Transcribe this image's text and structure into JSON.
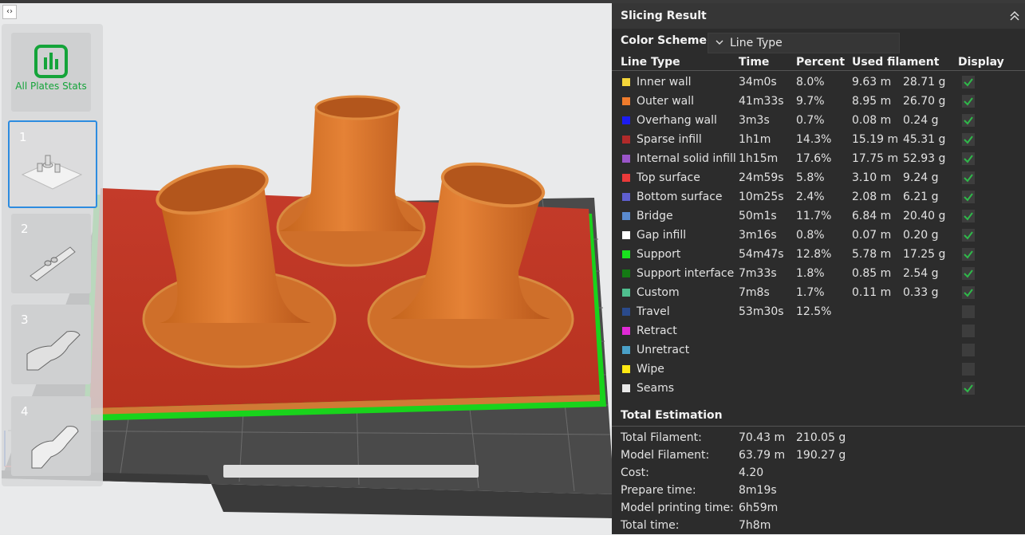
{
  "plates": {
    "stats_label": "All Plates Stats",
    "items": [
      {
        "num": "1"
      },
      {
        "num": "2"
      },
      {
        "num": "3"
      },
      {
        "num": "4"
      }
    ]
  },
  "panel": {
    "title": "Slicing Result",
    "scheme_label": "Color Scheme",
    "scheme_value": "Line Type",
    "headers": {
      "line_type": "Line Type",
      "time": "Time",
      "percent": "Percent",
      "used_filament": "Used filament",
      "display": "Display"
    },
    "rows": [
      {
        "name": "Inner wall",
        "color": "#f5d63a",
        "time": "34m0s",
        "percent": "8.0%",
        "length": "9.63 m",
        "weight": "28.71 g",
        "checked": true
      },
      {
        "name": "Outer wall",
        "color": "#ef7b2c",
        "time": "41m33s",
        "percent": "9.7%",
        "length": "8.95 m",
        "weight": "26.70 g",
        "checked": true
      },
      {
        "name": "Overhang wall",
        "color": "#1c1cf2",
        "time": "3m3s",
        "percent": "0.7%",
        "length": "0.08 m",
        "weight": "0.24 g",
        "checked": true
      },
      {
        "name": "Sparse infill",
        "color": "#b12a2a",
        "time": "1h1m",
        "percent": "14.3%",
        "length": "15.19 m",
        "weight": "45.31 g",
        "checked": true
      },
      {
        "name": "Internal solid infill",
        "color": "#9a55c9",
        "time": "1h15m",
        "percent": "17.6%",
        "length": "17.75 m",
        "weight": "52.93 g",
        "checked": true
      },
      {
        "name": "Top surface",
        "color": "#ea3a3a",
        "time": "24m59s",
        "percent": "5.8%",
        "length": "3.10 m",
        "weight": "9.24 g",
        "checked": true
      },
      {
        "name": "Bottom surface",
        "color": "#5f5fcf",
        "time": "10m25s",
        "percent": "2.4%",
        "length": "2.08 m",
        "weight": "6.21 g",
        "checked": true
      },
      {
        "name": "Bridge",
        "color": "#5a8bcf",
        "time": "50m1s",
        "percent": "11.7%",
        "length": "6.84 m",
        "weight": "20.40 g",
        "checked": true
      },
      {
        "name": "Gap infill",
        "color": "#ffffff",
        "time": "3m16s",
        "percent": "0.8%",
        "length": "0.07 m",
        "weight": "0.20 g",
        "checked": true
      },
      {
        "name": "Support",
        "color": "#19e31e",
        "time": "54m47s",
        "percent": "12.8%",
        "length": "5.78 m",
        "weight": "17.25 g",
        "checked": true
      },
      {
        "name": "Support interface",
        "color": "#147a14",
        "time": "7m33s",
        "percent": "1.8%",
        "length": "0.85 m",
        "weight": "2.54 g",
        "checked": true
      },
      {
        "name": "Custom",
        "color": "#4fbf8f",
        "time": "7m8s",
        "percent": "1.7%",
        "length": "0.11 m",
        "weight": "0.33 g",
        "checked": true
      },
      {
        "name": "Travel",
        "color": "#2a4a8c",
        "time": "53m30s",
        "percent": "12.5%",
        "length": "",
        "weight": "",
        "checked": false
      },
      {
        "name": "Retract",
        "color": "#e02ad6",
        "time": "",
        "percent": "",
        "length": "",
        "weight": "",
        "checked": false
      },
      {
        "name": "Unretract",
        "color": "#4aa0c8",
        "time": "",
        "percent": "",
        "length": "",
        "weight": "",
        "checked": false
      },
      {
        "name": "Wipe",
        "color": "#ffe812",
        "time": "",
        "percent": "",
        "length": "",
        "weight": "",
        "checked": false
      },
      {
        "name": "Seams",
        "color": "#e8e8e8",
        "time": "",
        "percent": "",
        "length": "",
        "weight": "",
        "checked": true
      }
    ],
    "estimation_title": "Total Estimation",
    "estimation": [
      {
        "label": "Total Filament:",
        "v1": "70.43 m",
        "v2": "210.05 g"
      },
      {
        "label": "Model Filament:",
        "v1": "63.79 m",
        "v2": "190.27 g"
      },
      {
        "label": "Cost:",
        "v1": "4.20",
        "v2": ""
      },
      {
        "label": "Prepare time:",
        "v1": "8m19s",
        "v2": ""
      },
      {
        "label": "Model printing time:",
        "v1": "6h59m",
        "v2": ""
      },
      {
        "label": "Total time:",
        "v1": "7h8m",
        "v2": ""
      }
    ]
  }
}
